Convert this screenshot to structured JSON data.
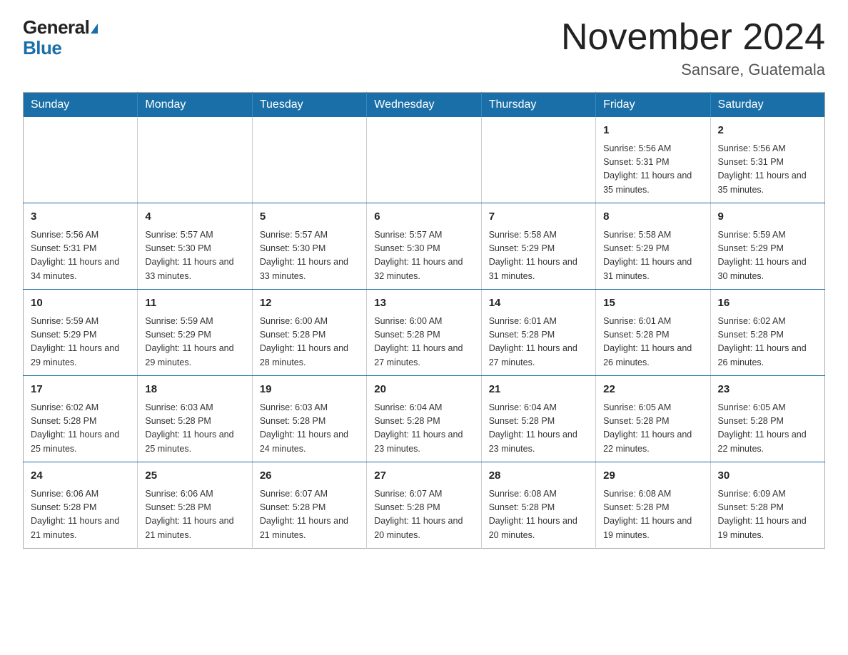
{
  "logo": {
    "general": "General",
    "blue": "Blue"
  },
  "header": {
    "month": "November 2024",
    "location": "Sansare, Guatemala"
  },
  "weekdays": [
    "Sunday",
    "Monday",
    "Tuesday",
    "Wednesday",
    "Thursday",
    "Friday",
    "Saturday"
  ],
  "weeks": [
    [
      {
        "day": "",
        "info": ""
      },
      {
        "day": "",
        "info": ""
      },
      {
        "day": "",
        "info": ""
      },
      {
        "day": "",
        "info": ""
      },
      {
        "day": "",
        "info": ""
      },
      {
        "day": "1",
        "info": "Sunrise: 5:56 AM\nSunset: 5:31 PM\nDaylight: 11 hours and 35 minutes."
      },
      {
        "day": "2",
        "info": "Sunrise: 5:56 AM\nSunset: 5:31 PM\nDaylight: 11 hours and 35 minutes."
      }
    ],
    [
      {
        "day": "3",
        "info": "Sunrise: 5:56 AM\nSunset: 5:31 PM\nDaylight: 11 hours and 34 minutes."
      },
      {
        "day": "4",
        "info": "Sunrise: 5:57 AM\nSunset: 5:30 PM\nDaylight: 11 hours and 33 minutes."
      },
      {
        "day": "5",
        "info": "Sunrise: 5:57 AM\nSunset: 5:30 PM\nDaylight: 11 hours and 33 minutes."
      },
      {
        "day": "6",
        "info": "Sunrise: 5:57 AM\nSunset: 5:30 PM\nDaylight: 11 hours and 32 minutes."
      },
      {
        "day": "7",
        "info": "Sunrise: 5:58 AM\nSunset: 5:29 PM\nDaylight: 11 hours and 31 minutes."
      },
      {
        "day": "8",
        "info": "Sunrise: 5:58 AM\nSunset: 5:29 PM\nDaylight: 11 hours and 31 minutes."
      },
      {
        "day": "9",
        "info": "Sunrise: 5:59 AM\nSunset: 5:29 PM\nDaylight: 11 hours and 30 minutes."
      }
    ],
    [
      {
        "day": "10",
        "info": "Sunrise: 5:59 AM\nSunset: 5:29 PM\nDaylight: 11 hours and 29 minutes."
      },
      {
        "day": "11",
        "info": "Sunrise: 5:59 AM\nSunset: 5:29 PM\nDaylight: 11 hours and 29 minutes."
      },
      {
        "day": "12",
        "info": "Sunrise: 6:00 AM\nSunset: 5:28 PM\nDaylight: 11 hours and 28 minutes."
      },
      {
        "day": "13",
        "info": "Sunrise: 6:00 AM\nSunset: 5:28 PM\nDaylight: 11 hours and 27 minutes."
      },
      {
        "day": "14",
        "info": "Sunrise: 6:01 AM\nSunset: 5:28 PM\nDaylight: 11 hours and 27 minutes."
      },
      {
        "day": "15",
        "info": "Sunrise: 6:01 AM\nSunset: 5:28 PM\nDaylight: 11 hours and 26 minutes."
      },
      {
        "day": "16",
        "info": "Sunrise: 6:02 AM\nSunset: 5:28 PM\nDaylight: 11 hours and 26 minutes."
      }
    ],
    [
      {
        "day": "17",
        "info": "Sunrise: 6:02 AM\nSunset: 5:28 PM\nDaylight: 11 hours and 25 minutes."
      },
      {
        "day": "18",
        "info": "Sunrise: 6:03 AM\nSunset: 5:28 PM\nDaylight: 11 hours and 25 minutes."
      },
      {
        "day": "19",
        "info": "Sunrise: 6:03 AM\nSunset: 5:28 PM\nDaylight: 11 hours and 24 minutes."
      },
      {
        "day": "20",
        "info": "Sunrise: 6:04 AM\nSunset: 5:28 PM\nDaylight: 11 hours and 23 minutes."
      },
      {
        "day": "21",
        "info": "Sunrise: 6:04 AM\nSunset: 5:28 PM\nDaylight: 11 hours and 23 minutes."
      },
      {
        "day": "22",
        "info": "Sunrise: 6:05 AM\nSunset: 5:28 PM\nDaylight: 11 hours and 22 minutes."
      },
      {
        "day": "23",
        "info": "Sunrise: 6:05 AM\nSunset: 5:28 PM\nDaylight: 11 hours and 22 minutes."
      }
    ],
    [
      {
        "day": "24",
        "info": "Sunrise: 6:06 AM\nSunset: 5:28 PM\nDaylight: 11 hours and 21 minutes."
      },
      {
        "day": "25",
        "info": "Sunrise: 6:06 AM\nSunset: 5:28 PM\nDaylight: 11 hours and 21 minutes."
      },
      {
        "day": "26",
        "info": "Sunrise: 6:07 AM\nSunset: 5:28 PM\nDaylight: 11 hours and 21 minutes."
      },
      {
        "day": "27",
        "info": "Sunrise: 6:07 AM\nSunset: 5:28 PM\nDaylight: 11 hours and 20 minutes."
      },
      {
        "day": "28",
        "info": "Sunrise: 6:08 AM\nSunset: 5:28 PM\nDaylight: 11 hours and 20 minutes."
      },
      {
        "day": "29",
        "info": "Sunrise: 6:08 AM\nSunset: 5:28 PM\nDaylight: 11 hours and 19 minutes."
      },
      {
        "day": "30",
        "info": "Sunrise: 6:09 AM\nSunset: 5:28 PM\nDaylight: 11 hours and 19 minutes."
      }
    ]
  ]
}
